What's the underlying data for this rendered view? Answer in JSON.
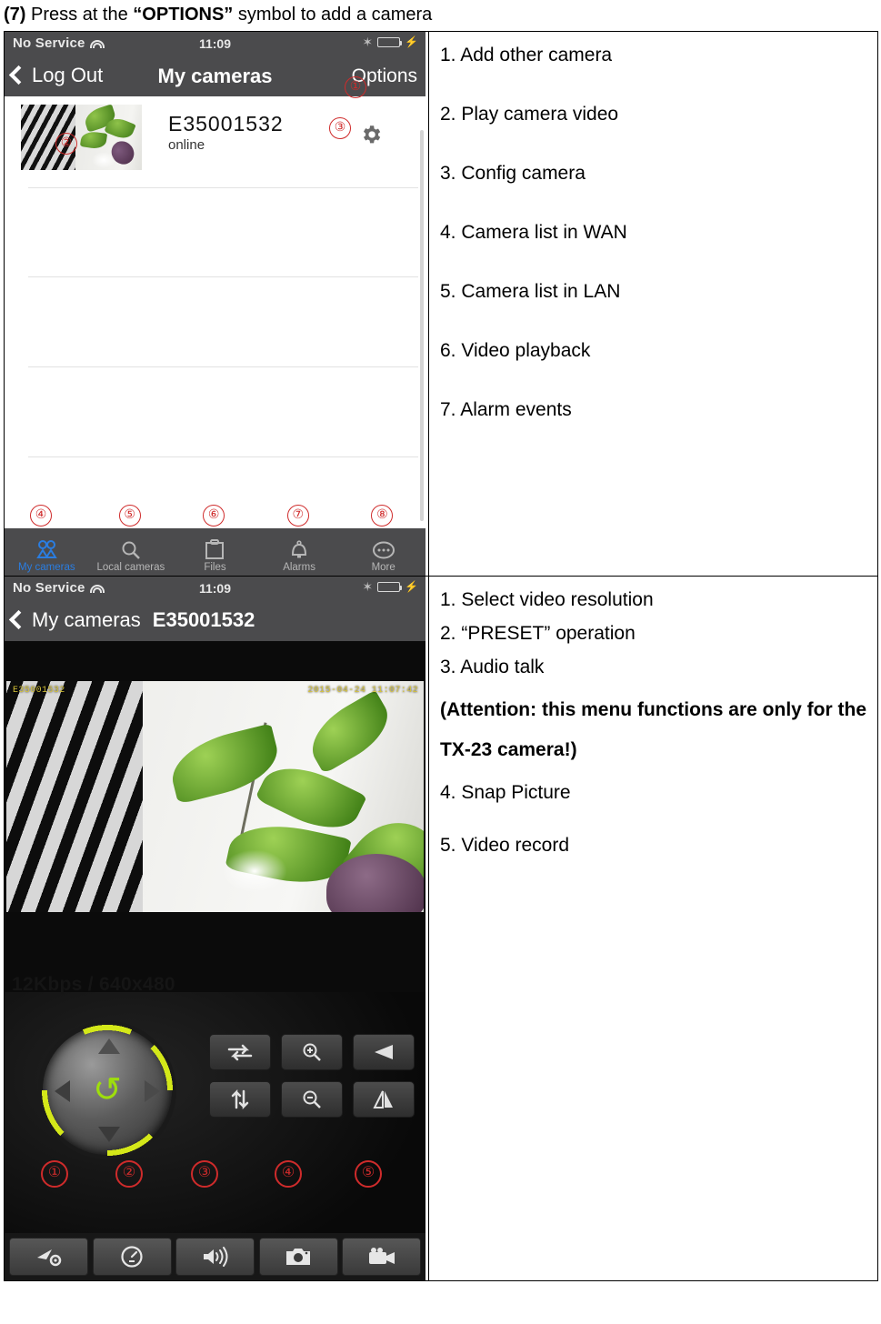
{
  "heading": {
    "prefix": "(7)",
    "text_before": " Press at the ",
    "quoted": "“OPTIONS”",
    "text_after": " symbol to add a camera"
  },
  "row1": {
    "phone": {
      "status_bar": {
        "carrier": "No Service",
        "wifi_icon": "wifi-icon",
        "time": "11:09",
        "bluetooth_icon": "bluetooth-icon",
        "battery_icon": "battery-icon",
        "charging_icon": "charging-bolt-icon"
      },
      "nav": {
        "back_icon": "chevron-left-icon",
        "back_label": "Log Out",
        "title": "My cameras",
        "right_label": "Options"
      },
      "camera": {
        "name": "E35001532",
        "status": "online",
        "gear_icon": "gear-icon"
      },
      "tabs": [
        {
          "label": "My cameras",
          "icon": "my-cameras-icon",
          "active": true
        },
        {
          "label": "Local cameras",
          "icon": "magnifier-icon",
          "active": false
        },
        {
          "label": "Files",
          "icon": "clipboard-icon",
          "active": false
        },
        {
          "label": "Alarms",
          "icon": "bell-icon",
          "active": false
        },
        {
          "label": "More",
          "icon": "ellipsis-icon",
          "active": false
        }
      ],
      "markers": [
        "①",
        "②",
        "③",
        "④",
        "⑤",
        "⑥",
        "⑦",
        "⑧"
      ]
    },
    "notes": [
      "1. Add other camera",
      "2. Play camera video",
      "3. Config camera",
      "4. Camera list in WAN",
      "5. Camera list in LAN",
      "6. Video playback",
      "7. Alarm events"
    ]
  },
  "row2": {
    "phone": {
      "status_bar": {
        "carrier": "No Service",
        "wifi_icon": "wifi-icon",
        "time": "11:09",
        "bluetooth_icon": "bluetooth-icon",
        "battery_icon": "battery-icon",
        "charging_icon": "charging-bolt-icon"
      },
      "nav": {
        "back_icon": "chevron-left-icon",
        "back_label": "My cameras",
        "title": "E35001532"
      },
      "video": {
        "osd_id": "E35001532",
        "osd_timestamp": "2015-04-24 11:07:42",
        "bitrate": "12Kbps / 640x480"
      },
      "joystick": {
        "up_icon": "arrow-up-icon",
        "down_icon": "arrow-down-icon",
        "left_icon": "arrow-left-icon",
        "right_icon": "arrow-right-icon",
        "center_icon": "refresh-cycle-icon"
      },
      "controls": [
        {
          "icon": "horizontal-patrol-icon"
        },
        {
          "icon": "zoom-in-icon"
        },
        {
          "icon": "iris-open-icon"
        },
        {
          "icon": "vertical-patrol-icon"
        },
        {
          "icon": "zoom-out-icon"
        },
        {
          "icon": "mirror-flip-icon"
        }
      ],
      "toolbar": [
        {
          "icon": "resolution-settings-icon"
        },
        {
          "icon": "preset-dial-icon"
        },
        {
          "icon": "speaker-icon"
        },
        {
          "icon": "camera-snapshot-icon"
        },
        {
          "icon": "video-record-icon"
        }
      ],
      "markers": [
        "①",
        "②",
        "③",
        "④",
        "⑤"
      ]
    },
    "notes": [
      "1. Select video resolution",
      "2. “PRESET” operation",
      "3. Audio talk",
      "(Attention: this menu functions are only for the TX-23 camera!)",
      "4. Snap Picture",
      "5. Video record"
    ]
  },
  "colors": {
    "bar_gray": "#4b4b4d",
    "accent_blue": "#2a7de1",
    "marker_red": "#cf2b2b",
    "battery_green": "#3fd63f",
    "joystick_yellow": "#d4e819"
  }
}
